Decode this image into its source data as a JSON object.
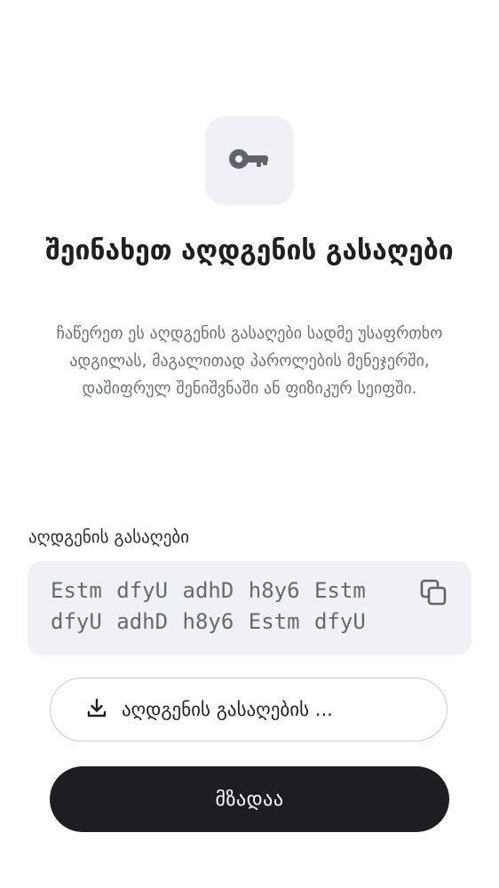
{
  "header": {
    "icon": "key-icon",
    "title": "შეინახეთ აღდგენის გასაღები",
    "description": "ჩაწერეთ ეს აღდგენის გასაღები სადმე უსაფრთხო ადგილას, მაგალითად პაროლების მენეჯერში, დაშიფრულ შენიშვნაში ან ფიზიკურ სეიფში."
  },
  "recovery_key": {
    "label": "აღდგენის გასაღები",
    "value": "Estm dfyU adhD h8y6 Estm dfyU adhD h8y6 Estm dfyU",
    "copy_icon": "copy-icon"
  },
  "actions": {
    "download_icon": "download-icon",
    "download_label": "აღდგენის გასაღების ...",
    "done_label": "მზადაა"
  },
  "colors": {
    "tile_background": "#eff1f5",
    "primary_button": "#1d1e22",
    "muted_text": "#6b6f78",
    "icon_gray": "#5f636b"
  }
}
